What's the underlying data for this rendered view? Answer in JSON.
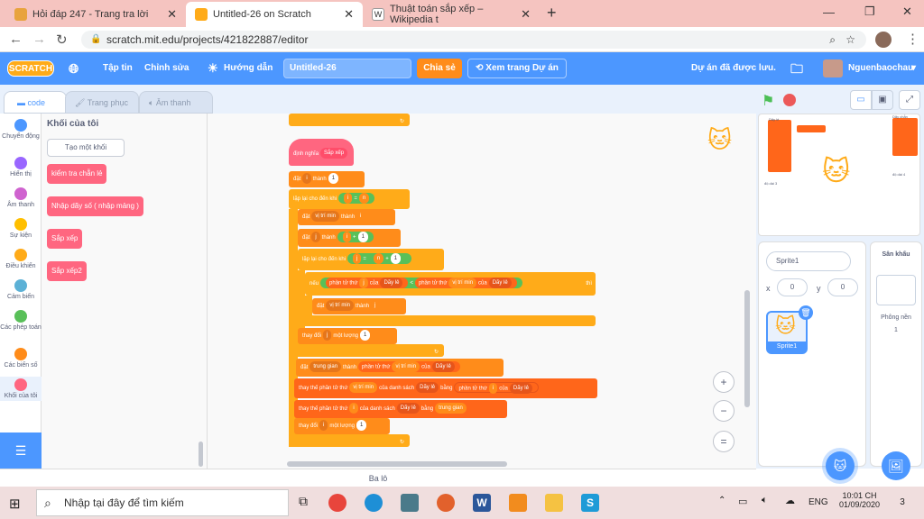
{
  "browser": {
    "tabs": [
      {
        "title": "Hỏi đáp 247 - Trang tra lời",
        "color": "#e8a33d"
      },
      {
        "title": "Untitled-26 on Scratch",
        "color": "#ffab19"
      },
      {
        "title": "Thuật toán sắp xếp – Wikipedia t",
        "color": "#ffffff"
      }
    ],
    "new_tab": "+",
    "url": "scratch.mit.edu/projects/421822887/editor"
  },
  "menubar": {
    "logo": "SCRATCH",
    "file": "Tập tin",
    "edit": "Chỉnh sửa",
    "tutorials": "Hướng dẫn",
    "project_title": "Untitled-26",
    "share": "Chia sẻ",
    "see_project": "Xem trang Dự án",
    "saved": "Dự án đã được lưu.",
    "username": "Nguenbaochau"
  },
  "editor_tabs": {
    "code": "code",
    "costumes": "Trang phục",
    "sounds": "Âm thanh"
  },
  "categories": [
    {
      "label": "Chuyển động",
      "color": "#4c97ff"
    },
    {
      "label": "Hiển thị",
      "color": "#9966ff"
    },
    {
      "label": "Âm thanh",
      "color": "#cf63cf"
    },
    {
      "label": "Sự kiện",
      "color": "#ffbf00"
    },
    {
      "label": "Điều khiển",
      "color": "#ffab19"
    },
    {
      "label": "Cảm biến",
      "color": "#5cb1d6"
    },
    {
      "label": "Các phép toán",
      "color": "#59c059"
    },
    {
      "label": "Các biến số",
      "color": "#ff8c1a"
    },
    {
      "label": "Khối của tôi",
      "color": "#ff6680"
    }
  ],
  "palette": {
    "heading": "Khối của tôi",
    "make_block": "Tạo một khối",
    "blocks": [
      "kiểm tra chẵn lẻ",
      "Nhập dãy số ( nhập mảng )",
      "Sắp xếp",
      "Sắp xếp2"
    ]
  },
  "script": {
    "define": "định nghĩa",
    "define_name": "Sắp xếp",
    "set": "đặt",
    "to": "thành",
    "i": "i",
    "j": "j",
    "n": "n",
    "one": "1",
    "repeat_until": "lặp lại cho đến khi",
    "eq": "=",
    "vitrimin": "vị trí min",
    "plus": "+",
    "if": "nếu",
    "then": "thì",
    "item": "phần tử thứ",
    "of": "của",
    "list": "Dãy lẻ",
    "lt": "<",
    "change": "thay đổi",
    "by": "một lượng",
    "trunggian": "trung gian",
    "replace": "thay thế phần tử thứ",
    "of_list": "của danh sách",
    "with": "bằng"
  },
  "stage": {
    "list_label": "Dãy lẻ",
    "length_label": "độ dài 3",
    "list2_label": "Dãy chẵn",
    "list2_length": "độ dài 4"
  },
  "sprite_panel": {
    "name": "Sprite1",
    "x_label": "x",
    "x": "0",
    "y_label": "y",
    "y": "0",
    "thumb_label": "Sprite1",
    "stage_title": "Sân khấu",
    "backdrops_label": "Phông nền",
    "backdrops_count": "1"
  },
  "backpack": "Ba lô",
  "taskbar": {
    "search_placeholder": "Nhập tại đây để tìm kiếm",
    "lang": "ENG",
    "time": "10:01 CH",
    "date": "01/09/2020",
    "notif": "3"
  }
}
